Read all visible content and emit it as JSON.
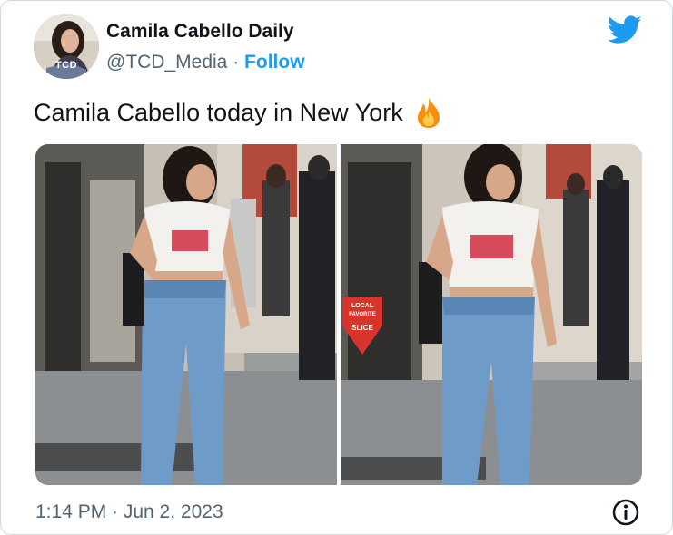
{
  "account": {
    "display_name": "Camila Cabello Daily",
    "handle": "@TCD_Media",
    "separator": "·",
    "follow_label": "Follow",
    "avatar_badge": "TCD"
  },
  "tweet": {
    "text": "Camila Cabello today in New York",
    "emoji_icon": "fire-icon"
  },
  "media": {
    "count": 2,
    "sign_text": [
      "LOCAL",
      "FAVORITE",
      "SLICE"
    ]
  },
  "footer": {
    "timestamp": "1:14 PM · Jun 2, 2023",
    "info_icon": "info-icon"
  },
  "colors": {
    "accent": "#1d9bf0",
    "text_primary": "#0f1419",
    "text_secondary": "#536471",
    "border": "#cfd9de"
  }
}
